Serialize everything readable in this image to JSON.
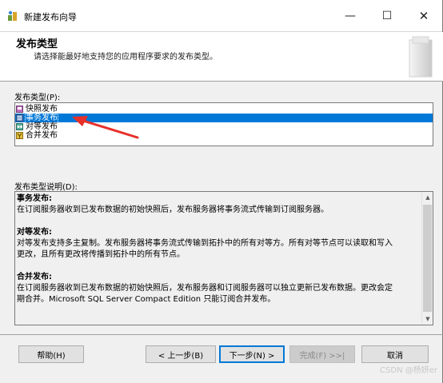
{
  "window": {
    "title": "新建发布向导",
    "minimize_icon": "minimize-icon",
    "maximize_icon": "maximize-icon",
    "close_icon": "close-icon"
  },
  "header": {
    "title": "发布类型",
    "subtitle": "请选择能最好地支持您的应用程序要求的发布类型。"
  },
  "publication_types": {
    "label": "发布类型(P):",
    "selected_index": 1,
    "items": [
      {
        "label": "快照发布",
        "icon": "snapshot-publication-icon"
      },
      {
        "label": "事务发布",
        "icon": "transactional-publication-icon"
      },
      {
        "label": "对等发布",
        "icon": "peer-to-peer-publication-icon"
      },
      {
        "label": "合并发布",
        "icon": "merge-publication-icon"
      }
    ]
  },
  "description": {
    "label": "发布类型说明(D):",
    "sections": [
      {
        "heading": "事务发布:",
        "lines": [
          "在订阅服务器收到已发布数据的初始快照后，发布服务器将事务流式传输到订阅服务器。"
        ]
      },
      {
        "heading": "对等发布:",
        "lines": [
          "对等发布支持多主复制。发布服务器将事务流式传输到拓扑中的所有对等方。所有对等节点可以读取和写入",
          "更改，且所有更改将传播到拓扑中的所有节点。"
        ]
      },
      {
        "heading": "合并发布:",
        "lines": [
          "在订阅服务器收到已发布数据的初始快照后，发布服务器和订阅服务器可以独立更新已发布数据。更改会定",
          "期合并。Microsoft SQL Server Compact Edition 只能订阅合并发布。"
        ]
      }
    ]
  },
  "buttons": {
    "help": "帮助(H)",
    "back": "< 上一步(B)",
    "next": "下一步(N) >",
    "finish": "完成(F) >>|",
    "cancel": "取消"
  },
  "watermark": "CSDN @杨妍er",
  "colors": {
    "selection": "#0078d7",
    "annotation_arrow": "#e8302a"
  }
}
